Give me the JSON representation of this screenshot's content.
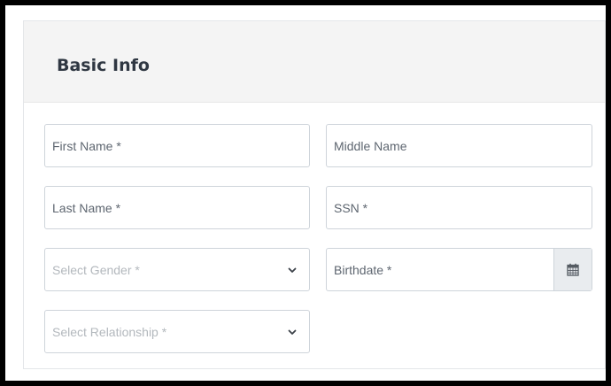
{
  "card": {
    "title": "Basic Info"
  },
  "fields": {
    "first_name": {
      "placeholder": "First Name *"
    },
    "middle_name": {
      "placeholder": "Middle Name"
    },
    "last_name": {
      "placeholder": "Last Name *"
    },
    "ssn": {
      "placeholder": "SSN *"
    },
    "gender": {
      "placeholder": "Select Gender *",
      "icon": "chevron-down-icon"
    },
    "birthdate": {
      "placeholder": "Birthdate *",
      "icon": "calendar-icon"
    },
    "relationship": {
      "placeholder": "Select Relationship *",
      "icon": "chevron-down-icon"
    }
  },
  "colors": {
    "header_bg": "#f4f4f4",
    "border": "#ced4da",
    "placeholder": "#5e6670",
    "select_placeholder": "#b3b8bd",
    "addon_bg": "#e9ecef"
  }
}
